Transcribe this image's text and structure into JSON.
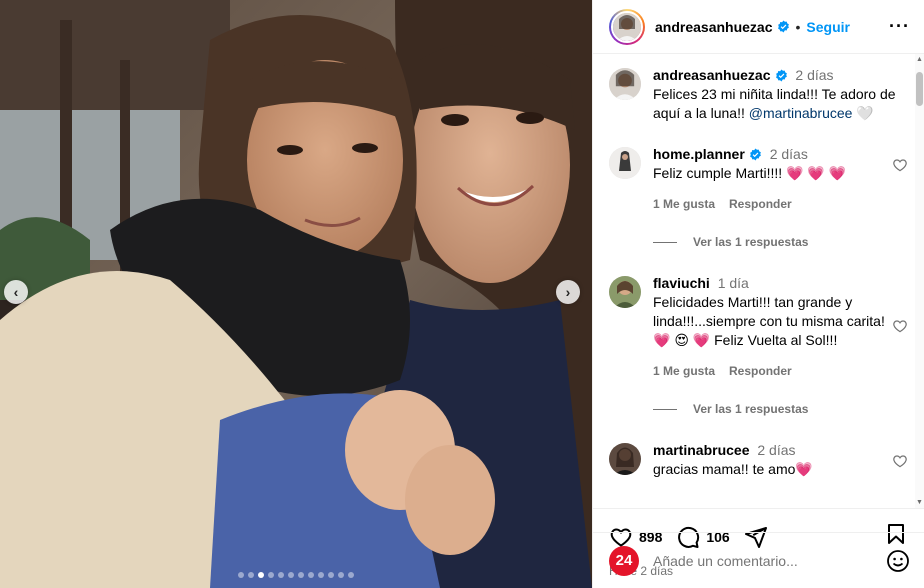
{
  "header": {
    "username": "andreasanhuezac",
    "bullet": "•",
    "follow_label": "Seguir",
    "more_label": "···"
  },
  "caption": {
    "username": "andreasanhuezac",
    "time": "2 días",
    "text": "Felices 23 mi niñita linda!!! Te adoro de aquí a la luna!! ",
    "mention": "@martinabrucee",
    "emoji": "🤍"
  },
  "comments": [
    {
      "username": "home.planner",
      "time": "2 días",
      "text": "Feliz cumple Marti!!!! ",
      "emoji": "💗 💗 💗",
      "likes_label": "1 Me gusta",
      "reply_label": "Responder",
      "replies_label": "Ver las 1 respuestas"
    },
    {
      "username": "flaviuchi",
      "time": "1 día",
      "text": "Felicidades Marti!!! tan grande y linda!!!...siempre con tu misma carita! 💗 😍 💗  Feliz Vuelta al Sol!!!",
      "likes_label": "1 Me gusta",
      "reply_label": "Responder",
      "replies_label": "Ver las 1 respuestas"
    },
    {
      "username": "martinabrucee",
      "time": "2 días",
      "text": "gracias mama!! te amo",
      "emoji": "💗"
    }
  ],
  "actions": {
    "likes_count": "898",
    "comments_count": "106"
  },
  "post_date": "Hace 2 días",
  "add_comment": {
    "logo_text": "24",
    "placeholder": "Añade un comentario..."
  },
  "carousel": {
    "prev_glyph": "‹",
    "next_glyph": "›",
    "total_slides": 12,
    "active_slide": 3
  },
  "colors": {
    "follow_blue": "#0095f6",
    "verified_blue": "#0095f6",
    "logo_red": "#e4152a",
    "mention": "#00376b"
  }
}
